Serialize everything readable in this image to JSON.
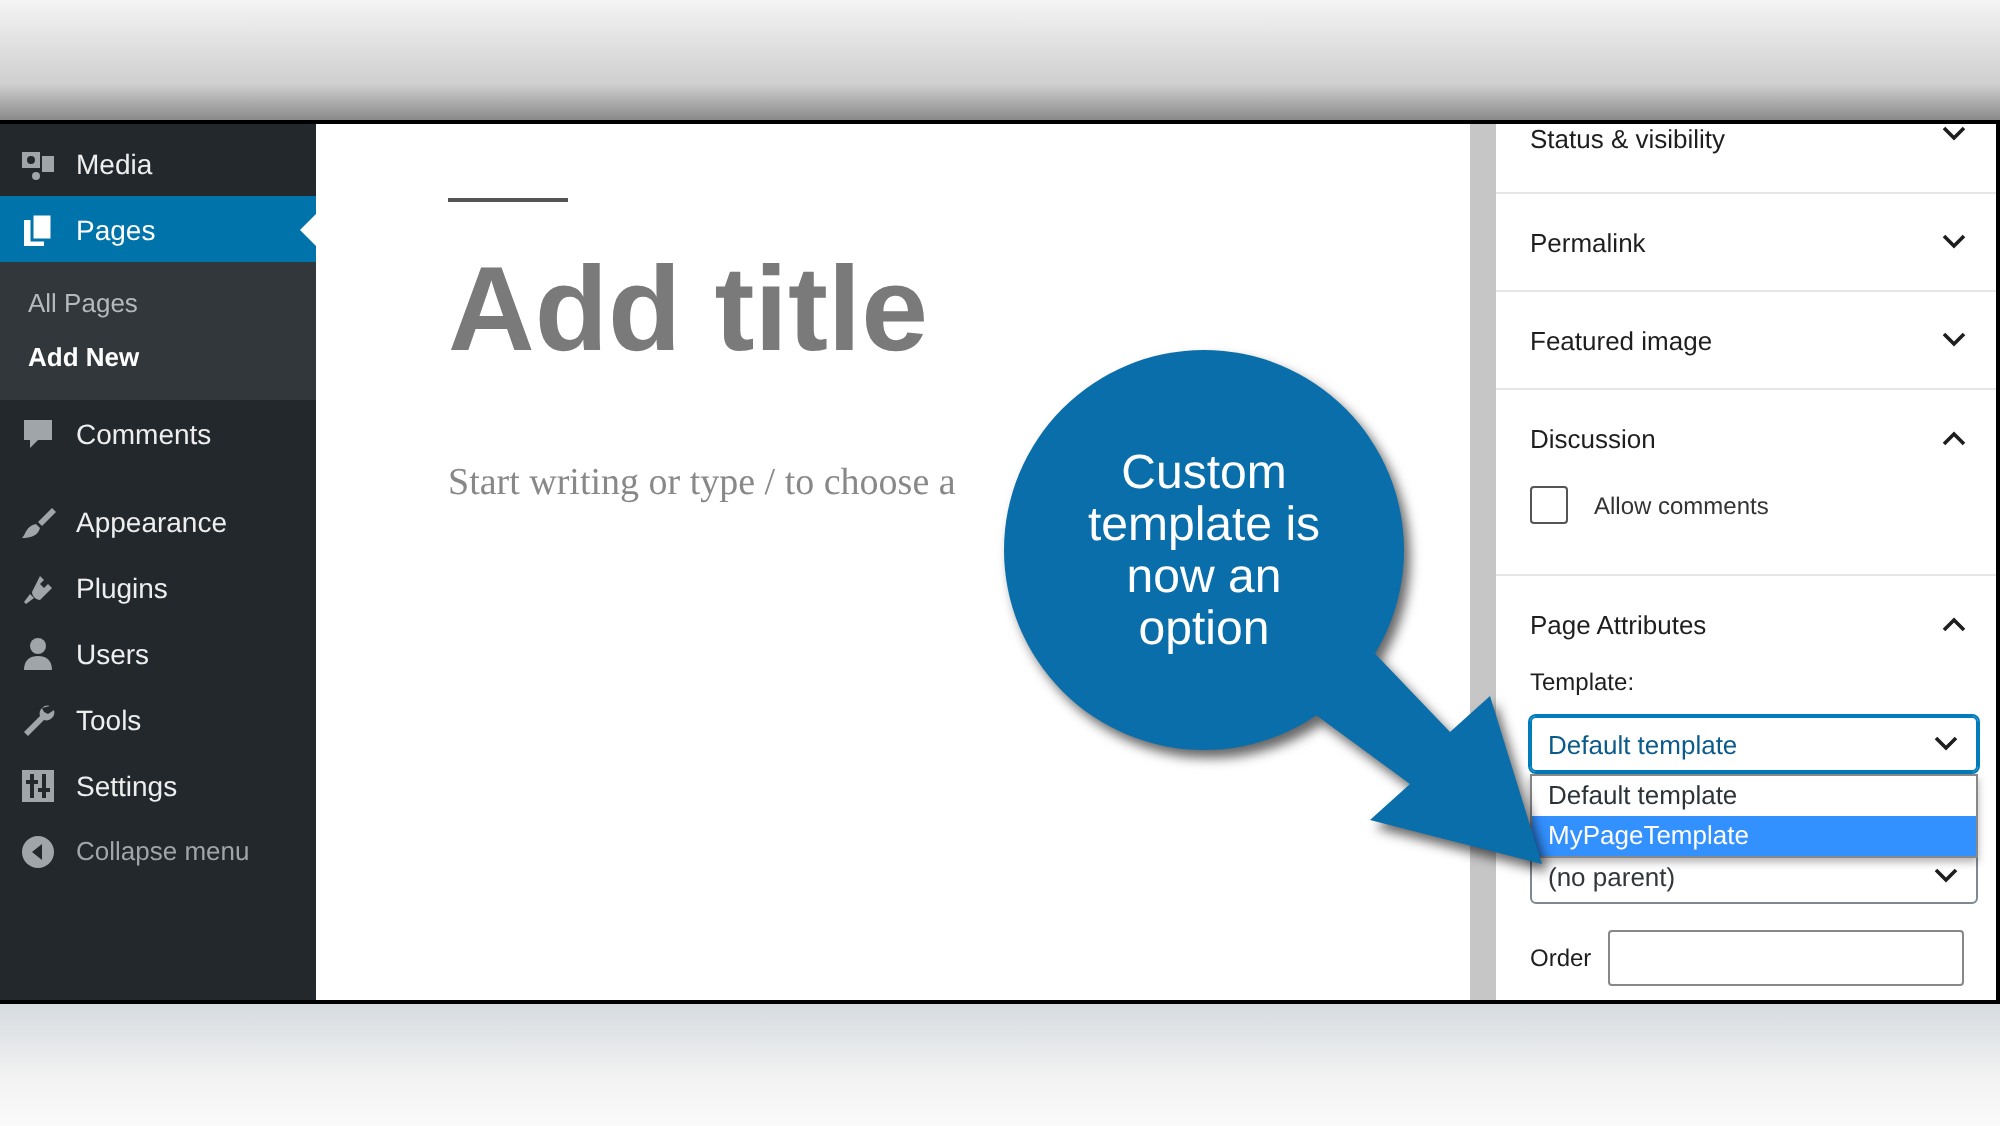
{
  "sidebar": {
    "items": [
      {
        "label": "Media",
        "selected": false
      },
      {
        "label": "Pages",
        "selected": true,
        "children": [
          {
            "label": "All Pages",
            "selected": false
          },
          {
            "label": "Add New",
            "selected": true
          }
        ]
      },
      {
        "label": "Comments",
        "selected": false
      },
      {
        "label": "Appearance",
        "selected": false
      },
      {
        "label": "Plugins",
        "selected": false
      },
      {
        "label": "Users",
        "selected": false
      },
      {
        "label": "Tools",
        "selected": false
      },
      {
        "label": "Settings",
        "selected": false
      }
    ],
    "collapse": "Collapse menu"
  },
  "editor": {
    "title_placeholder": "Add title",
    "body_placeholder": "Start writing or type / to choose a"
  },
  "settings_panels": [
    {
      "title": "Status & visibility",
      "expanded": false
    },
    {
      "title": "Permalink",
      "expanded": false
    },
    {
      "title": "Featured image",
      "expanded": false
    },
    {
      "title": "Discussion",
      "expanded": true,
      "checkbox": {
        "label": "Allow comments",
        "checked": false
      }
    },
    {
      "title": "Page Attributes",
      "expanded": true,
      "template_label": "Template:",
      "template_value": "Default template",
      "template_options": [
        {
          "label": "Default template",
          "selected": false
        },
        {
          "label": "MyPageTemplate",
          "selected": true
        }
      ],
      "parent_value": "(no parent)",
      "order_label": "Order"
    }
  ],
  "callout": {
    "text": "Custom template is now an option"
  }
}
